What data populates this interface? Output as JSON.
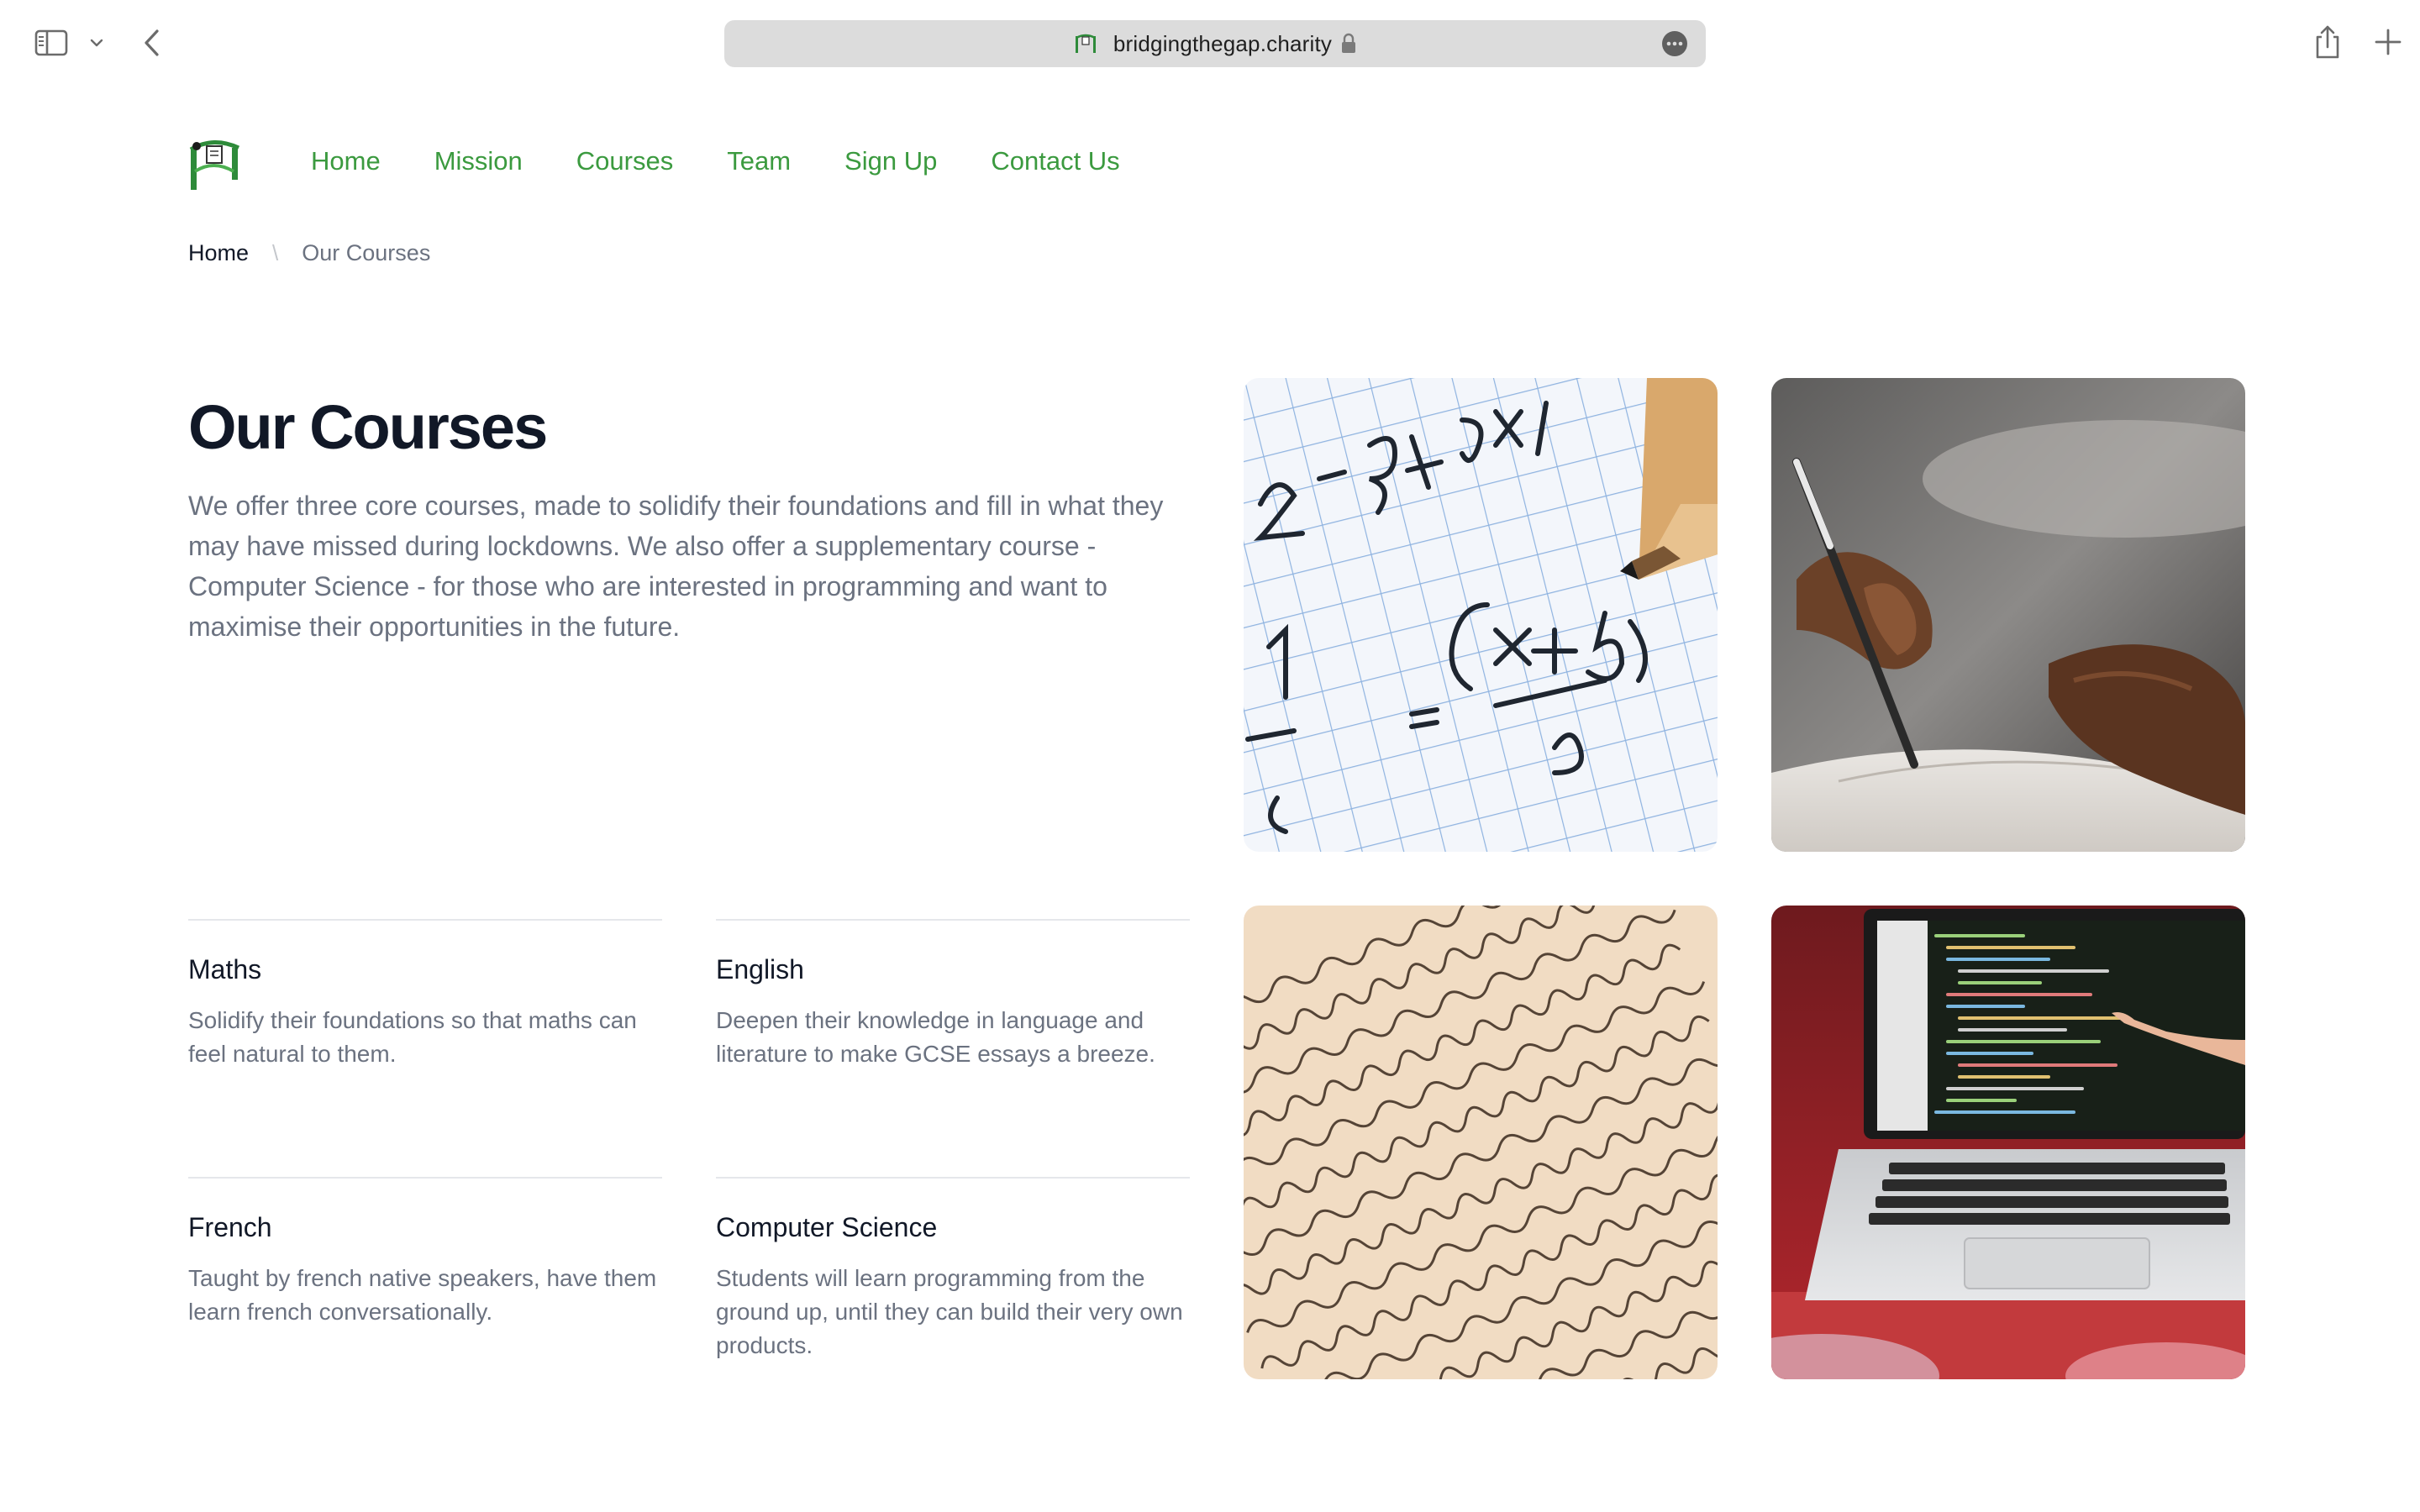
{
  "browser": {
    "url": "bridgingthegap.charity",
    "icons": [
      "sidebar-icon",
      "chevron-down-icon",
      "back-arrow-icon",
      "lock-icon",
      "more-icon",
      "share-icon",
      "plus-icon"
    ]
  },
  "nav": {
    "items": [
      {
        "label": "Home"
      },
      {
        "label": "Mission"
      },
      {
        "label": "Courses"
      },
      {
        "label": "Team"
      },
      {
        "label": "Sign Up"
      },
      {
        "label": "Contact Us"
      }
    ]
  },
  "breadcrumb": {
    "home": "Home",
    "separator": "\\",
    "current": "Our Courses"
  },
  "page": {
    "title": "Our Courses",
    "intro": "We offer three core courses, made to solidify their foundations and fill in what they may have missed during lockdowns. We also offer a supplementary course - Computer Science - for those who are interested in programming and want to maximise their opportunities in the future."
  },
  "courses": [
    {
      "title": "Maths",
      "description": "Solidify their foundations so that maths can feel natural to them."
    },
    {
      "title": "English",
      "description": "Deepen their knowledge in language and literature to make GCSE essays a breeze."
    },
    {
      "title": "French",
      "description": "Taught by french native speakers, have them learn french conversationally."
    },
    {
      "title": "Computer Science",
      "description": "Students will learn programming from the ground up, until they can build their very own products."
    }
  ],
  "colors": {
    "brand_green": "#3b9a3f",
    "heading": "#111827",
    "muted": "#6b7280",
    "divider": "#e5e7eb"
  }
}
